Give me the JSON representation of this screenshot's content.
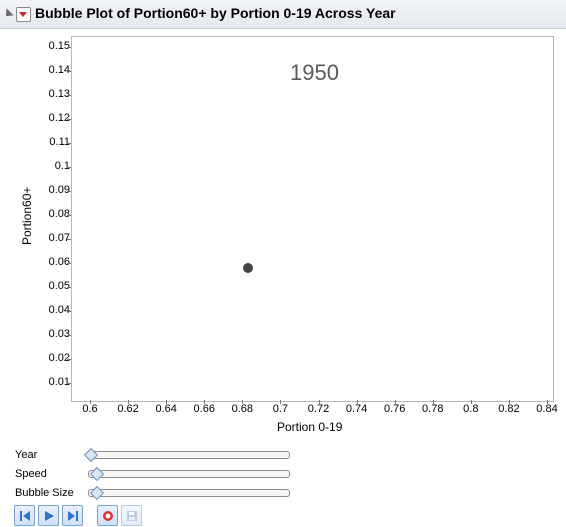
{
  "window": {
    "title": "Bubble Plot of Portion60+  by Portion 0-19 Across Year"
  },
  "chart_data": {
    "type": "scatter",
    "title": "Bubble Plot of Portion60+  by Portion 0-19 Across Year",
    "xlabel": "Portion 0-19",
    "ylabel": "Portion60+",
    "xlim": [
      0.6,
      0.84
    ],
    "ylim": [
      0.01,
      0.15
    ],
    "x_ticks": [
      "0.6",
      "0.62",
      "0.64",
      "0.66",
      "0.68",
      "0.7",
      "0.72",
      "0.74",
      "0.76",
      "0.78",
      "0.8",
      "0.82",
      "0.84"
    ],
    "y_ticks": [
      "0.15",
      "0.14",
      "0.13",
      "0.12",
      "0.11",
      "0.1",
      "0.09",
      "0.08",
      "0.07",
      "0.06",
      "0.05",
      "0.04",
      "0.03",
      "0.02",
      "0.01"
    ],
    "frame_label": "1950",
    "points": [
      {
        "x": 0.683,
        "y": 0.058
      }
    ]
  },
  "controls": {
    "sliders": [
      {
        "label": "Year",
        "value": 0
      },
      {
        "label": "Speed",
        "value": 0.03
      },
      {
        "label": "Bubble Size",
        "value": 0.03
      }
    ]
  },
  "buttons": {
    "step_back_icon": "step-back-icon",
    "play_icon": "play-icon",
    "step_forward_icon": "step-forward-icon",
    "record_icon": "record-icon",
    "save_icon": "save-icon"
  }
}
